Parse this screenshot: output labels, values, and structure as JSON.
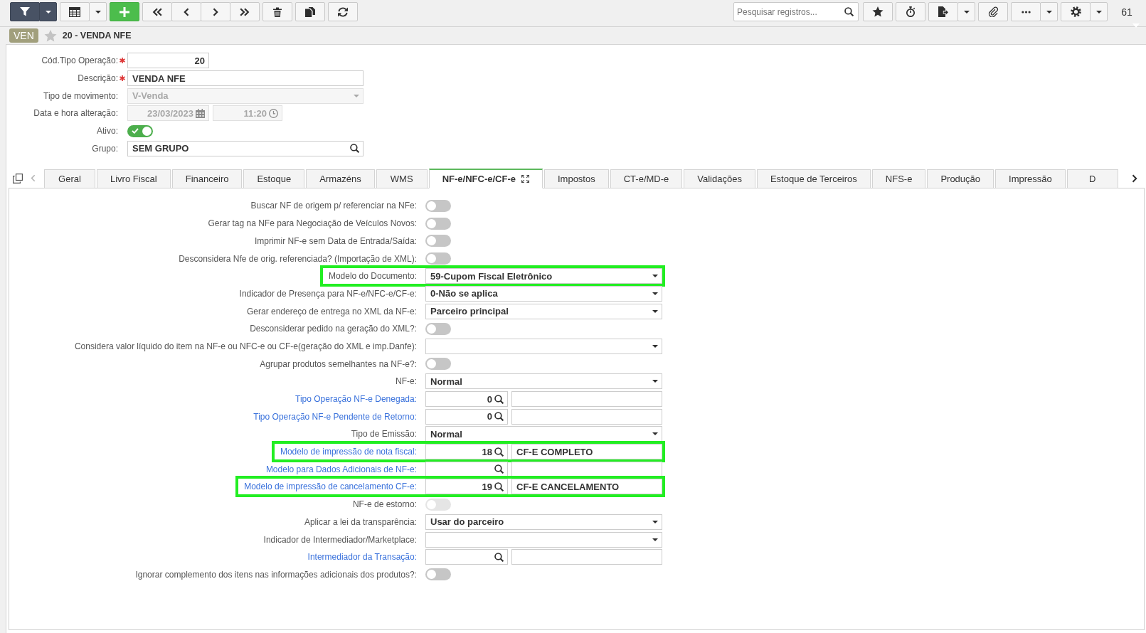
{
  "toolbar": {
    "search": {
      "placeholder": "Pesquisar registros..."
    },
    "record_count": "61"
  },
  "record": {
    "badge": "VEN",
    "favorite": false,
    "title": "20 - VENDA NFE"
  },
  "header": {
    "fields": [
      {
        "kind": "number",
        "label": "Cód.Tipo Operação:",
        "required": true,
        "disabled": false,
        "value": "20"
      },
      {
        "kind": "text",
        "label": "Descrição:",
        "required": true,
        "disabled": false,
        "value": "VENDA NFE"
      },
      {
        "kind": "select",
        "label": "Tipo de movimento:",
        "required": false,
        "disabled": true,
        "value": "V-Venda"
      },
      {
        "kind": "datetime",
        "label": "Data e hora alteração:",
        "required": false,
        "disabled": true,
        "date": "23/03/2023",
        "time": "11:20"
      },
      {
        "kind": "toggle",
        "label": "Ativo:",
        "required": false,
        "disabled": false,
        "on": true
      },
      {
        "kind": "lookup",
        "label": "Grupo:",
        "required": false,
        "disabled": false,
        "value": "SEM GRUPO"
      }
    ]
  },
  "tabs": [
    {
      "label": "Geral",
      "selected": false
    },
    {
      "label": "Livro Fiscal",
      "selected": false
    },
    {
      "label": "Financeiro",
      "selected": false
    },
    {
      "label": "Estoque",
      "selected": false
    },
    {
      "label": "Armazéns",
      "selected": false
    },
    {
      "label": "WMS",
      "selected": false
    },
    {
      "label": "NF-e/NFC-e/CF-e",
      "selected": true
    },
    {
      "label": "Impostos",
      "selected": false
    },
    {
      "label": "CT-e/MD-e",
      "selected": false
    },
    {
      "label": "Validações",
      "selected": false
    },
    {
      "label": "Estoque de Terceiros",
      "selected": false
    },
    {
      "label": "NFS-e",
      "selected": false
    },
    {
      "label": "Produção",
      "selected": false
    },
    {
      "label": "Impressão",
      "selected": false
    },
    {
      "label": "D",
      "selected": false
    }
  ],
  "tab_content": {
    "rows": [
      {
        "kind": "toggle",
        "label": "Buscar NF de origem p/ referenciar na NFe:",
        "highlighted": false,
        "disabled": false,
        "on": false
      },
      {
        "kind": "toggle",
        "label": "Gerar tag na NFe para Negociação de Veículos Novos:",
        "highlighted": false,
        "disabled": false,
        "on": false
      },
      {
        "kind": "toggle",
        "label": "Imprimir NF-e sem Data de Entrada/Saída:",
        "highlighted": false,
        "disabled": false,
        "on": false
      },
      {
        "kind": "toggle",
        "label": "Desconsidera Nfe de orig. referenciada? (Importação de XML):",
        "highlighted": false,
        "disabled": false,
        "on": false
      },
      {
        "kind": "select",
        "label": "Modelo do Documento:",
        "highlighted": true,
        "disabled": false,
        "value": "59-Cupom Fiscal Eletrônico"
      },
      {
        "kind": "select",
        "label": "Indicador de Presença para NF-e/NFC-e/CF-e:",
        "highlighted": false,
        "disabled": false,
        "value": "0-Não se aplica"
      },
      {
        "kind": "select",
        "label": "Gerar endereço de entrega no XML da NF-e:",
        "highlighted": false,
        "disabled": false,
        "value": "Parceiro principal"
      },
      {
        "kind": "toggle",
        "label": "Desconsiderar pedido na geração do XML?:",
        "highlighted": false,
        "disabled": false,
        "on": false
      },
      {
        "kind": "select",
        "label": "Considera valor líquido do item na NF-e ou NFC-e ou CF-e(geração do XML e imp.Danfe):",
        "highlighted": false,
        "disabled": false
      },
      {
        "kind": "toggle",
        "label": "Agrupar produtos semelhantes na NF-e?:",
        "highlighted": false,
        "disabled": false,
        "on": false
      },
      {
        "kind": "select",
        "label": "NF-e:",
        "highlighted": false,
        "disabled": false,
        "value": "Normal"
      },
      {
        "kind": "lookup",
        "label": "Tipo Operação NF-e Denegada:",
        "highlighted": false,
        "disabled": false,
        "code": "0"
      },
      {
        "kind": "lookup",
        "label": "Tipo Operação NF-e Pendente de Retorno:",
        "highlighted": false,
        "disabled": false,
        "code": "0"
      },
      {
        "kind": "select",
        "label": "Tipo de Emissão:",
        "highlighted": false,
        "disabled": false,
        "value": "Normal"
      },
      {
        "kind": "lookup",
        "label": "Modelo de impressão de nota fiscal:",
        "highlighted": true,
        "disabled": false,
        "code": "18",
        "description": "CF-E COMPLETO"
      },
      {
        "kind": "lookup",
        "label": "Modelo para Dados Adicionais de NF-e:",
        "highlighted": false,
        "disabled": false
      },
      {
        "kind": "lookup",
        "label": "Modelo de impressão de cancelamento CF-e:",
        "highlighted": true,
        "disabled": false,
        "code": "19",
        "description": "CF-E CANCELAMENTO"
      },
      {
        "kind": "toggle",
        "label": "NF-e de estorno:",
        "highlighted": false,
        "disabled": true,
        "on": false
      },
      {
        "kind": "select",
        "label": "Aplicar a lei da transparência:",
        "highlighted": false,
        "disabled": false,
        "value": "Usar do parceiro"
      },
      {
        "kind": "select",
        "label": "Indicador de Intermediador/Marketplace:",
        "highlighted": false,
        "disabled": false
      },
      {
        "kind": "lookup",
        "label": "Intermediador da Transação:",
        "highlighted": false,
        "disabled": false
      },
      {
        "kind": "toggle",
        "label": "Ignorar complemento dos itens nas informações adicionais dos produtos?:",
        "highlighted": false,
        "disabled": false,
        "on": false
      }
    ]
  }
}
